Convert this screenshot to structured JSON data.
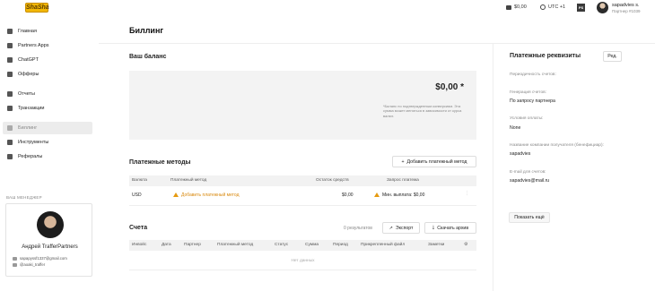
{
  "topbar": {
    "logo_text": "ShaSha",
    "balance": "$0,00",
    "timezone": "UTC +1",
    "ps_badge": "PS",
    "user_name": "sapadvies s.",
    "user_sub": "Партнер #1039"
  },
  "sidebar": {
    "items": [
      {
        "label": "Главная",
        "icon": "grid-icon"
      },
      {
        "label": "Partners Apps",
        "icon": "apps-icon"
      },
      {
        "label": "ChatGPT",
        "icon": "chat-icon"
      },
      {
        "label": "Офферы",
        "icon": "tag-icon"
      },
      {
        "label": "Отчеты",
        "icon": "chart-icon"
      },
      {
        "label": "Транзакции",
        "icon": "transactions-icon"
      },
      {
        "label": "Биллинг",
        "icon": "card-icon"
      },
      {
        "label": "Инструменты",
        "icon": "wrench-icon"
      },
      {
        "label": "Рефералы",
        "icon": "referral-icon"
      }
    ],
    "manager_title": "ВАШ МЕНЕДЖЕР",
    "manager_name": "Андрей TrafferPartners",
    "manager_email": "sapapyssf1337@gmail.com",
    "manager_tg": "@aoaki_traffer"
  },
  "main": {
    "title": "Биллинг",
    "balance_title": "Ваш баланс",
    "balance_amount": "$0,00 *",
    "balance_note": "*Баланс по подтвержденным конверсиям. Эта сумма может меняться в зависимости от курса валют.",
    "payment_methods_title": "Платежные методы",
    "add_payment_method": "Добавить платежный метод",
    "pm_headers": [
      "Валюта",
      "Платежный метод",
      "Остаток средств",
      "Запрос платежа"
    ],
    "pm_row": {
      "currency": "USD",
      "method": "Добавить платежный метод",
      "balance": "$0,00",
      "request": "Мин. выплата: $0,00"
    },
    "invoices_title": "Счета",
    "results": "0 результатов",
    "export": "Экспорт",
    "download_archive": "Скачать архив",
    "inv_headers": [
      "Инвойс",
      "Дата",
      "Партнер",
      "Платежный метод",
      "Статус",
      "Сумма",
      "Период",
      "Прикрепленный файл",
      "Заметки"
    ],
    "no_data": "Нет данных"
  },
  "requisites": {
    "title": "Платежные реквизиты",
    "edit": "Ред.",
    "fields": [
      {
        "label": "Периодичность счетов:",
        "value": ""
      },
      {
        "label": "Генерация счетов:",
        "value": "По запросу партнера"
      },
      {
        "label": "Условия оплаты:",
        "value": "None"
      },
      {
        "label": "Название компании получателя (бенефициар):",
        "value": "sapadvies"
      },
      {
        "label": "E-mail для счетов:",
        "value": "sapadvies@mail.ru"
      }
    ],
    "show_more": "Показать ещё"
  },
  "colors": {
    "warning": "#e69a10",
    "active_bg": "#ececec",
    "balance_bg": "#f3f3f3"
  }
}
